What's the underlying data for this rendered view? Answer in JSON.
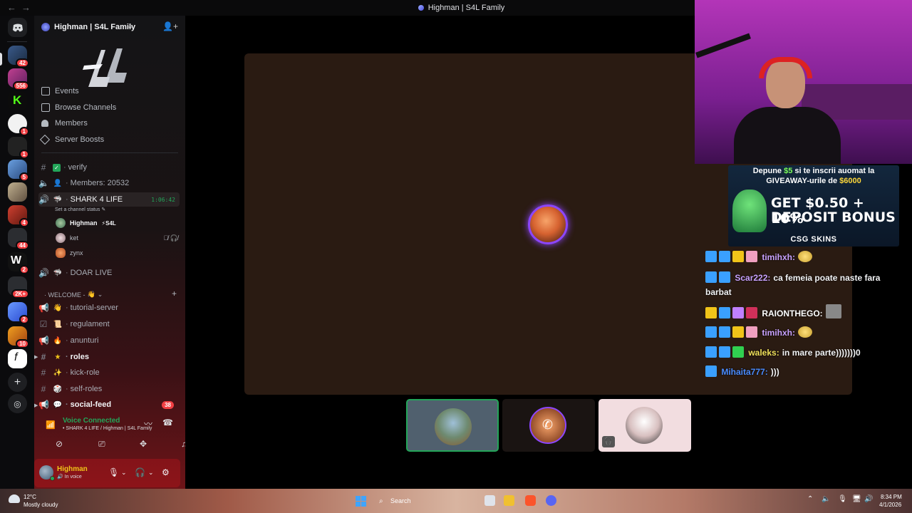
{
  "window": {
    "title": "Highman | S4L Family",
    "back": "←",
    "forward": "→"
  },
  "rail": {
    "badges": [
      "42",
      "556",
      "1",
      "1",
      "5",
      "4",
      "44",
      "2",
      "2K+",
      "2",
      "10"
    ]
  },
  "server": {
    "name": "Highman | S4L Family"
  },
  "menu": {
    "events": "Events",
    "browse": "Browse Channels",
    "members": "Members",
    "boosts": "Server Boosts"
  },
  "channels": {
    "verify": "verify",
    "members_count": "Members: 20532",
    "shark": "SHARK 4 LIFE",
    "shark_timer": "1:06:42",
    "shark_status": "Set a channel status",
    "doar_live": "DOAR LIVE",
    "welcome_cat": "WELCOME -",
    "tutorial": "tutorial-server",
    "regulament": "regulament",
    "anunturi": "anunturi",
    "roles": "roles",
    "kick_role": "kick-role",
    "self_roles": "self-roles",
    "social_feed": "social-feed",
    "social_badge": "38"
  },
  "voice_users": [
    {
      "name": "Highman",
      "tag": "S4L"
    },
    {
      "name": "ket"
    },
    {
      "name": "zynx"
    }
  ],
  "voice_panel": {
    "title": "Voice Connected",
    "subtitle": "SHARK 4 LIFE / Highman | S4L Family"
  },
  "user": {
    "name": "Highman",
    "status": "In voice"
  },
  "ad": {
    "line1_a": "Depune ",
    "line1_b": "$5",
    "line1_c": " si te inscrii auomat la",
    "line2_a": "GIVEAWAY-urile de ",
    "line2_b": "$6000",
    "big1": "GET $0.50 + 10%",
    "big2": "DEPOSIT BONUS",
    "brand": "CSG SKINS"
  },
  "chat": [
    {
      "name": "timihxh:",
      "name_color": "#c8a2ff",
      "text": "",
      "emote": true
    },
    {
      "name": "Scar222:",
      "name_color": "#c8a2ff",
      "text": "ca femeia poate naste fara barbat"
    },
    {
      "name": "RAIONTHEGO:",
      "name_color": "#ffffff",
      "text": ""
    },
    {
      "name": "timihxh:",
      "name_color": "#c8a2ff",
      "text": "",
      "emote": true
    },
    {
      "name": "waleks:",
      "name_color": "#f0e05a",
      "text": "in mare parte)))))))0"
    },
    {
      "name": "Mihaita777:",
      "name_color": "#4a8cff",
      "text": ")))"
    }
  ],
  "taskbar": {
    "temp": "12°C",
    "weather": "Mostly cloudy",
    "search": "Search",
    "time": "8:34 PM",
    "date": "4/1/2026"
  },
  "colors": {
    "accent_green": "#23a559",
    "badge_red": "#f23f43",
    "speaking_ring": "#8c46ff"
  }
}
